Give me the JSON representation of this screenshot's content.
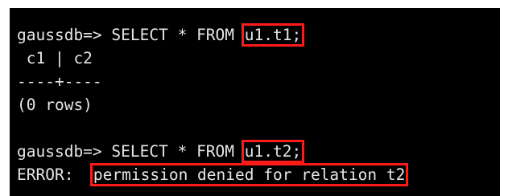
{
  "terminal": {
    "lines": [
      {
        "prompt": "gaussdb=> ",
        "command": "SELECT * FROM ",
        "highlight": "u1.t1;"
      },
      {
        "text": " c1 | c2"
      },
      {
        "text": "----+----"
      },
      {
        "text": "(0 rows)"
      },
      {
        "text": ""
      },
      {
        "prompt": "gaussdb=> ",
        "command": "SELECT * FROM ",
        "highlight": "u1.t2;"
      },
      {
        "label": "ERROR:  ",
        "highlight": "permission denied for relation t2"
      }
    ]
  },
  "colors": {
    "background": "#000000",
    "text": "#e6e6e6",
    "highlight_box": "#ff1a1a"
  }
}
